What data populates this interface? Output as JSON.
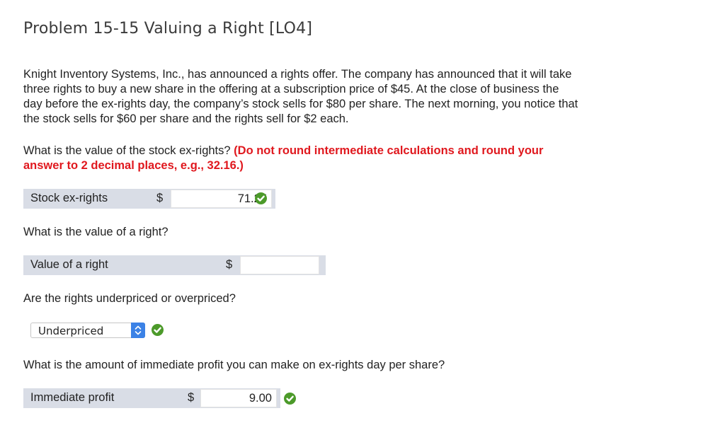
{
  "title": "Problem 15-15 Valuing a Right [LO4]",
  "paragraph": {
    "line1": "Knight Inventory Systems, Inc., has announced a rights offer. The company has announced that it will take",
    "line2": "three rights to buy a new share in the offering at a subscription price of $45. At the close of business the",
    "line3": "day before the ex-rights day, the company’s stock sells for $80 per share. The next morning, you notice that",
    "line4": "the stock sells for $60 per share and the rights sell for $2 each."
  },
  "q1": {
    "question": "What is the value of the stock ex-rights?",
    "instruction_line1": "(Do not round intermediate calculations and round your",
    "instruction_line2": "answer to 2 decimal places, e.g., 32.16.)",
    "label": "Stock ex-rights",
    "currency": "$",
    "value": "71.25",
    "status": "correct"
  },
  "q2": {
    "question": "What is the value of a right?",
    "label": "Value of a right",
    "currency": "$",
    "value": ""
  },
  "q3": {
    "question": "Are the rights underpriced or overpriced?",
    "selected": "Underpriced",
    "status": "correct"
  },
  "q4": {
    "question": "What is the amount of immediate profit you can make on ex-rights day per share?",
    "label": "Immediate profit",
    "currency": "$",
    "value": "9.00",
    "status": "correct"
  },
  "colors": {
    "instruction": "#e0181e",
    "row_bg": "#d9dde6",
    "check": "#4c9a2a",
    "select_arrow": "#3b82e6"
  },
  "icons": {
    "correct": "check-circle-icon",
    "select": "chevron-updown-icon"
  }
}
